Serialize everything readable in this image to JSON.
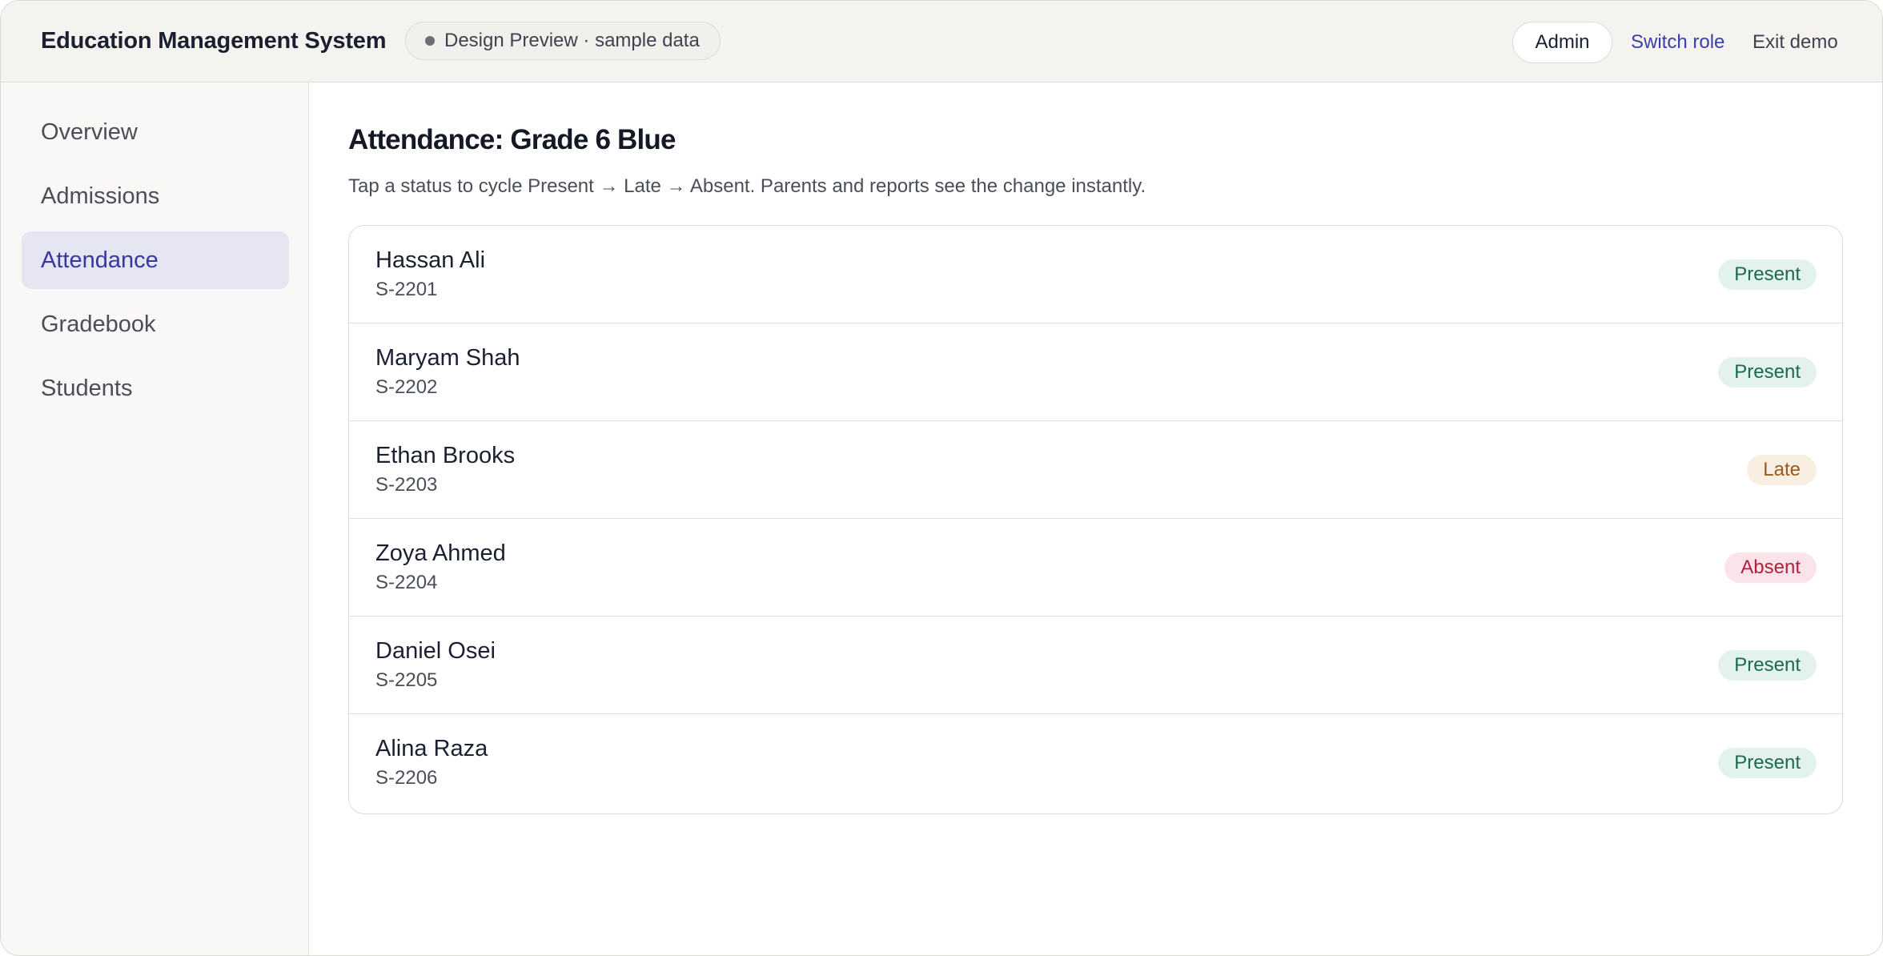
{
  "header": {
    "app_title": "Education Management System",
    "preview_badge": "Design Preview · sample data",
    "role": "Admin",
    "switch_role": "Switch role",
    "exit_demo": "Exit demo"
  },
  "sidebar": {
    "items": [
      {
        "label": "Overview",
        "active": false
      },
      {
        "label": "Admissions",
        "active": false
      },
      {
        "label": "Attendance",
        "active": true
      },
      {
        "label": "Gradebook",
        "active": false
      },
      {
        "label": "Students",
        "active": false
      }
    ]
  },
  "main": {
    "title": "Attendance: Grade 6 Blue",
    "subtitle": "Tap a status to cycle Present → Late → Absent. Parents and reports see the change instantly.",
    "students": [
      {
        "name": "Hassan Ali",
        "id": "S-2201",
        "status": "Present"
      },
      {
        "name": "Maryam Shah",
        "id": "S-2202",
        "status": "Present"
      },
      {
        "name": "Ethan Brooks",
        "id": "S-2203",
        "status": "Late"
      },
      {
        "name": "Zoya Ahmed",
        "id": "S-2204",
        "status": "Absent"
      },
      {
        "name": "Daniel Osei",
        "id": "S-2205",
        "status": "Present"
      },
      {
        "name": "Alina Raza",
        "id": "S-2206",
        "status": "Present"
      }
    ]
  },
  "colors": {
    "accent": "#343aa0",
    "present": "#1c6a4c",
    "late": "#9a5a1f",
    "absent": "#b0203f"
  }
}
